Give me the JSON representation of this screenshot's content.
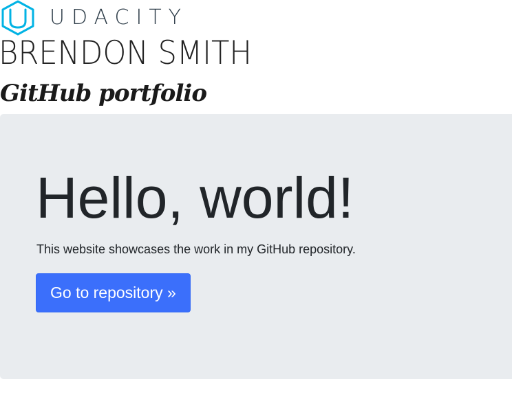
{
  "header": {
    "brand_name": "UDACITY",
    "brand_logo_icon": "udacity-u-icon",
    "brand_color": "#02b3e4",
    "owner_name": "BRENDON SMITH",
    "subtitle": "GitHub portfolio"
  },
  "jumbotron": {
    "heading": "Hello, world!",
    "lead": "This website showcases the work in my GitHub repository.",
    "button_label": "Go to repository »",
    "background_color": "#e9ecef",
    "button_color": "#3b6ffb"
  }
}
